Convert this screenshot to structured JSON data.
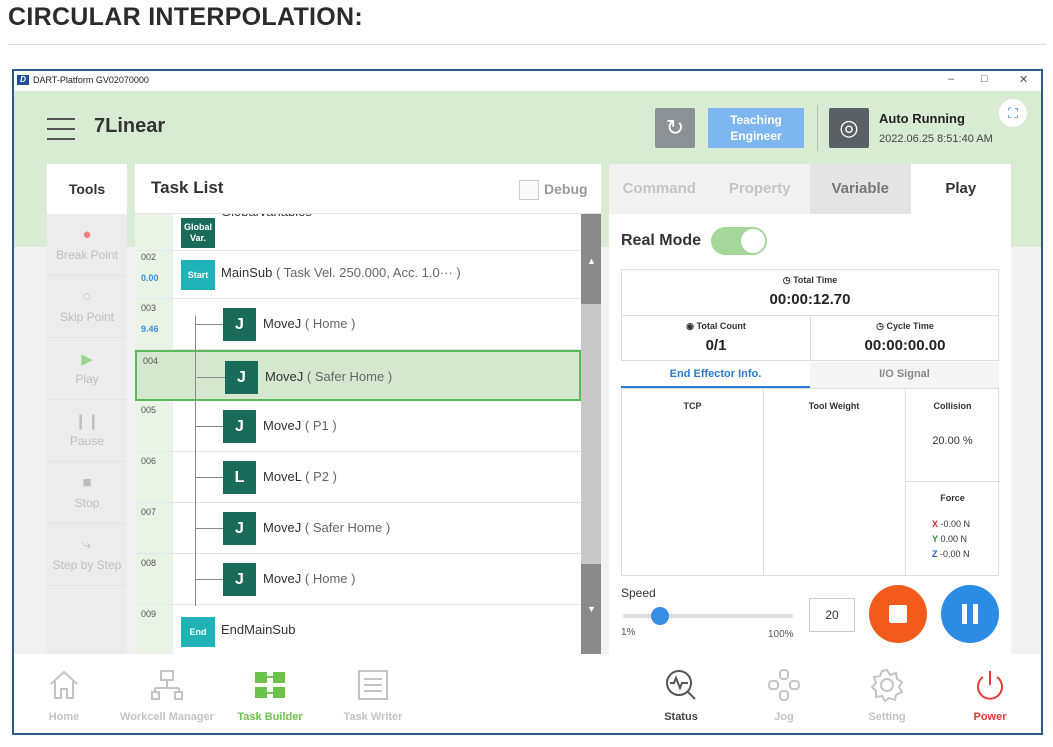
{
  "heading": "CIRCULAR INTERPOLATION:",
  "window": {
    "logo_letter": "D",
    "title": "DART-Platform GV02070000",
    "minimize": "–",
    "maximize": "□",
    "close": "✕"
  },
  "header": {
    "app_title": "7Linear",
    "reset_glyph": "↻",
    "teach_line1": "Teaching",
    "teach_line2": "Engineer",
    "mode_glyph": "◎",
    "mode": "Auto Running",
    "datetime": "2022.06.25 8:51:40 AM",
    "capture_glyph": "⛶"
  },
  "tools": {
    "title": "Tools",
    "items": [
      {
        "label": "Break Point",
        "icon": "●"
      },
      {
        "label": "Skip Point",
        "icon": "○"
      },
      {
        "label": "Play",
        "icon": "▶"
      },
      {
        "label": "Pause",
        "icon": "❙❙"
      },
      {
        "label": "Stop",
        "icon": "■"
      },
      {
        "label": "Step by Step",
        "icon": "⤷"
      }
    ]
  },
  "tasklist": {
    "title": "Task List",
    "debug": "Debug",
    "rows": [
      {
        "line": "",
        "sub": "",
        "tag": "Global\nVar.",
        "label": "GlobalVariables",
        "arg": "",
        "kind": "global"
      },
      {
        "line": "002",
        "sub": "0.00",
        "tag": "Start",
        "label": "MainSub",
        "arg": "( Task Vel. 250.000, Acc. 1.0··· )",
        "kind": "start"
      },
      {
        "line": "003",
        "sub": "9.46",
        "cmd": "J",
        "label": "MoveJ",
        "arg": "( Home )",
        "kind": "cmd"
      },
      {
        "line": "004",
        "sub": "",
        "cmd": "J",
        "label": "MoveJ",
        "arg": "( Safer Home )",
        "kind": "cmd",
        "selected": true
      },
      {
        "line": "005",
        "sub": "",
        "cmd": "J",
        "label": "MoveJ",
        "arg": "( P1 )",
        "kind": "cmd"
      },
      {
        "line": "006",
        "sub": "",
        "cmd": "L",
        "label": "MoveL",
        "arg": "( P2 )",
        "kind": "cmd"
      },
      {
        "line": "007",
        "sub": "",
        "cmd": "J",
        "label": "MoveJ",
        "arg": "( Safer Home )",
        "kind": "cmd"
      },
      {
        "line": "008",
        "sub": "",
        "cmd": "J",
        "label": "MoveJ",
        "arg": "( Home )",
        "kind": "cmd"
      },
      {
        "line": "009",
        "sub": "",
        "tag": "End",
        "label": "EndMainSub",
        "arg": "",
        "kind": "end"
      }
    ]
  },
  "right": {
    "tabs": [
      "Command",
      "Property",
      "Variable",
      "Play"
    ],
    "active_tab": "Play",
    "real_mode": "Real Mode",
    "real_mode_on": true,
    "total_time_label": "Total Time",
    "total_time": "00:00:12.70",
    "total_count_label": "Total Count",
    "total_count": "0/1",
    "cycle_time_label": "Cycle Time",
    "cycle_time": "00:00:00.00",
    "info_tabs": [
      "End Effector Info.",
      "I/O Signal"
    ],
    "tcp": "TCP",
    "tool_weight": "Tool Weight",
    "collision": "Collision",
    "collision_value": "20.00 %",
    "force": "Force",
    "force_x_label": "X",
    "force_x": "-0.00 N",
    "force_y_label": "Y",
    "force_y": "0.00 N",
    "force_z_label": "Z",
    "force_z": "-0.00 N",
    "speed_label": "Speed",
    "speed_min": "1%",
    "speed_max": "100%",
    "speed_value": "20"
  },
  "nav": [
    "Home",
    "Workcell Manager",
    "Task Builder",
    "Task Writer",
    "Status",
    "Jog",
    "Setting",
    "Power"
  ],
  "colors": {
    "accent_green": "#5cb85c",
    "header_bg": "#d8ecd4",
    "cmd_icon": "#1b6b5b",
    "stop": "#f35b1d",
    "pause": "#2c8be3",
    "power": "#e53935"
  }
}
